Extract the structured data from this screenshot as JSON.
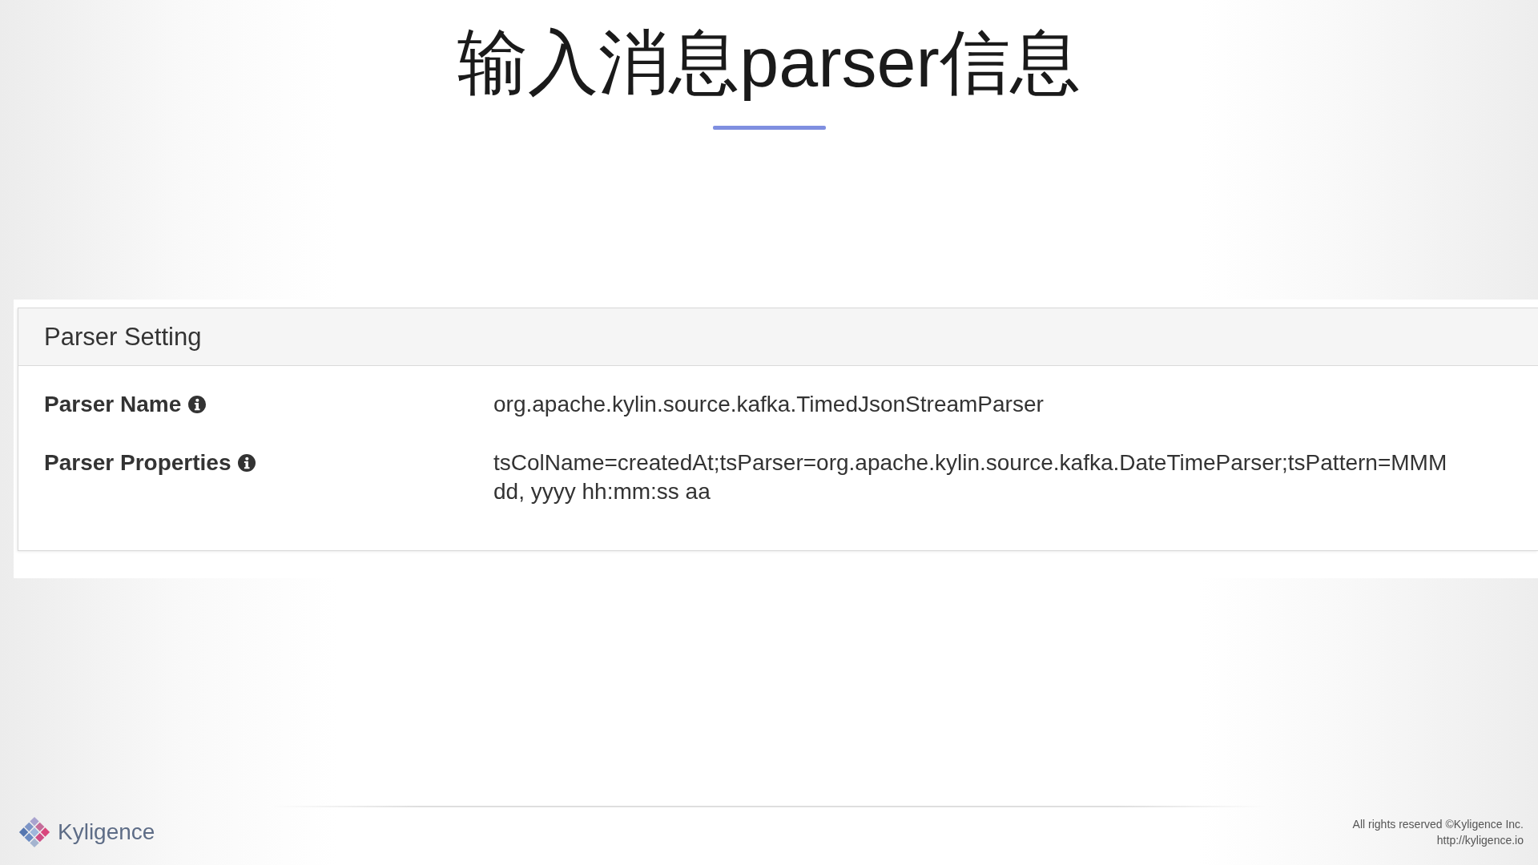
{
  "slide": {
    "title": "输入消息parser信息"
  },
  "panel": {
    "title": "Parser Setting",
    "rows": [
      {
        "label": "Parser Name",
        "value": "org.apache.kylin.source.kafka.TimedJsonStreamParser"
      },
      {
        "label": "Parser Properties",
        "value": "tsColName=createdAt;tsParser=org.apache.kylin.source.kafka.DateTimeParser;tsPattern=MMM dd, yyyy hh:mm:ss aa"
      }
    ]
  },
  "footer": {
    "brand": "Kyligence",
    "copyright": "All rights reserved ©Kyligence Inc.",
    "url": "http://kyligence.io"
  }
}
